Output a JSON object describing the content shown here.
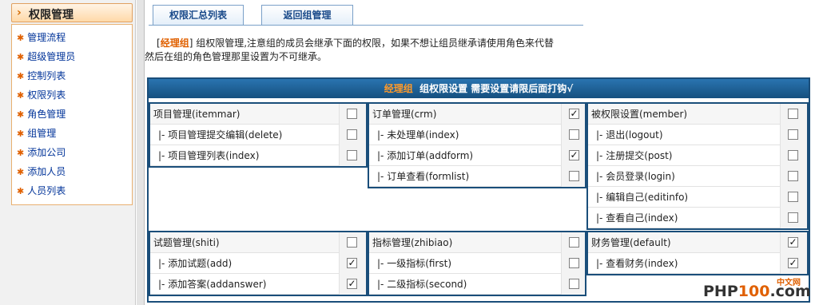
{
  "sidebar": {
    "title": "权限管理",
    "items": [
      {
        "label": "管理流程"
      },
      {
        "label": "超级管理员"
      },
      {
        "label": "控制列表"
      },
      {
        "label": "权限列表"
      },
      {
        "label": "角色管理"
      },
      {
        "label": "组管理"
      },
      {
        "label": "添加公司"
      },
      {
        "label": "添加人员"
      },
      {
        "label": "人员列表"
      }
    ]
  },
  "tabs": [
    {
      "label": "权限汇总列表"
    },
    {
      "label": "返回组管理"
    }
  ],
  "note": {
    "group": "经理组",
    "line1": "组权限管理,注意组的成员会继承下面的权限，如果不想让组员继承请使用角色来代替",
    "line2": "然后在组的角色管理那里设置为不可继承。"
  },
  "panel": {
    "group": "经理组",
    "header_text": "组权限设置 需要设置请限后面打钩√"
  },
  "modules": [
    {
      "name": "itemmar",
      "rows": [
        {
          "label": "项目管理(itemmar)",
          "checked": false
        },
        {
          "label": "|- 项目管理提交编辑(delete)",
          "checked": false
        },
        {
          "label": "|- 项目管理列表(index)",
          "checked": false
        }
      ]
    },
    {
      "name": "crm",
      "rows": [
        {
          "label": "订单管理(crm)",
          "checked": true
        },
        {
          "label": "|- 未处理单(index)",
          "checked": false
        },
        {
          "label": "|- 添加订单(addform)",
          "checked": true
        },
        {
          "label": "|- 订单查看(formlist)",
          "checked": false
        }
      ]
    },
    {
      "name": "member",
      "rows": [
        {
          "label": "被权限设置(member)",
          "checked": false
        },
        {
          "label": "|- 退出(logout)",
          "checked": false
        },
        {
          "label": "|- 注册提交(post)",
          "checked": false
        },
        {
          "label": "|- 会员登录(login)",
          "checked": false
        },
        {
          "label": "|- 编辑自己(editinfo)",
          "checked": false
        },
        {
          "label": "|- 查看自己(index)",
          "checked": false
        }
      ]
    },
    {
      "name": "shiti",
      "rows": [
        {
          "label": "试题管理(shiti)",
          "checked": false
        },
        {
          "label": "|- 添加试题(add)",
          "checked": true
        },
        {
          "label": "|- 添加答案(addanswer)",
          "checked": true
        }
      ]
    },
    {
      "name": "zhibiao",
      "rows": [
        {
          "label": "指标管理(zhibiao)",
          "checked": false
        },
        {
          "label": "|- 一级指标(first)",
          "checked": false
        },
        {
          "label": "|- 二级指标(second)",
          "checked": false
        }
      ]
    },
    {
      "name": "default",
      "rows": [
        {
          "label": "财务管理(default)",
          "checked": true
        },
        {
          "label": "|- 查看财务(index)",
          "checked": true
        }
      ]
    }
  ],
  "watermark": {
    "cn": "中文网",
    "logo_a": "PHP",
    "logo_b": "100",
    "logo_c": ".com"
  },
  "colors": {
    "accent": "#e06000",
    "panel_blue": "#1a4e7a",
    "link": "#003399"
  }
}
